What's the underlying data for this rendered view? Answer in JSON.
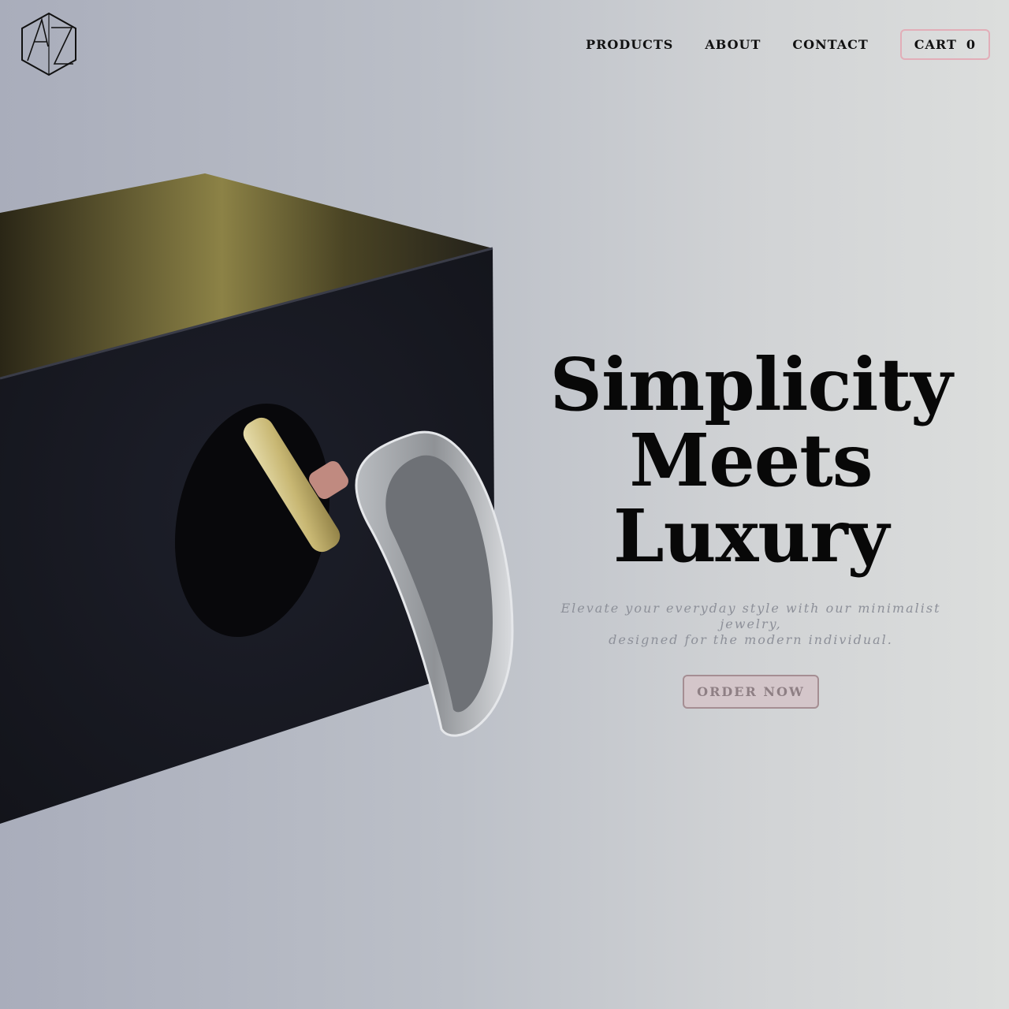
{
  "brand": {
    "logo_icon": "hexagon-monogram-logo"
  },
  "nav": {
    "items": [
      {
        "label": "PRODUCTS"
      },
      {
        "label": "ABOUT"
      },
      {
        "label": "CONTACT"
      }
    ],
    "cart": {
      "label": "CART",
      "count": "0"
    }
  },
  "hero": {
    "title_lines": [
      "Simplicity",
      "Meets",
      "Luxury"
    ],
    "subtitle_lines": [
      "Elevate your everyday style with our minimalist jewelry,",
      "designed for the modern individual."
    ],
    "cta_label": "ORDER NOW",
    "image": "ring-on-black-stone-block"
  },
  "colors": {
    "accent_border": "#e2aeb8",
    "cta_background": "#d4c6ca",
    "title_text": "#080808",
    "subtitle_text": "#8d9099"
  }
}
